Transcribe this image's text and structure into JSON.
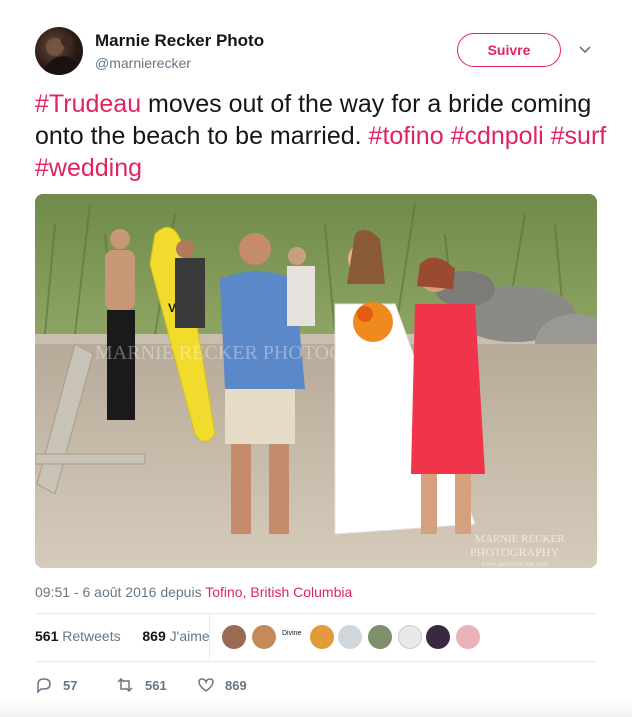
{
  "header": {
    "display_name": "Marnie Recker Photo",
    "handle": "@marnierecker",
    "follow_label": "Suivre"
  },
  "tweet": {
    "segments": [
      {
        "text": "#Trudeau",
        "hashtag": true
      },
      {
        "text": " moves out of the way for a bride coming onto the beach to be married. ",
        "hashtag": false
      },
      {
        "text": "#tofino",
        "hashtag": true
      },
      {
        "text": " ",
        "hashtag": false
      },
      {
        "text": "#cdnpoli",
        "hashtag": true
      },
      {
        "text": " ",
        "hashtag": false
      },
      {
        "text": "#surf",
        "hashtag": true
      },
      {
        "text": " ",
        "hashtag": false
      },
      {
        "text": "#wedding",
        "hashtag": true
      }
    ]
  },
  "photo": {
    "watermark_left": "MARNIE RECKER PHOTOGRAPHY",
    "watermark_right_1": "MARNIE RECKER",
    "watermark_right_2": "PHOTOGRAPHY",
    "watermark_right_3": "www.marnierecker.com",
    "surfboard_logo": "VS"
  },
  "meta": {
    "timestamp": "09:51 - 6 août 2016 depuis ",
    "place": "Tofino, British Columbia"
  },
  "stats": {
    "retweets_count": "561",
    "retweets_label": " Retweets",
    "likes_count": "869",
    "likes_label": " J'aime",
    "divine_label": "Divine"
  },
  "actions": {
    "reply_count": "57",
    "retweet_count": "561",
    "like_count": "869"
  },
  "colors": {
    "accent": "#e0245e",
    "text": "#14171a",
    "muted": "#657786",
    "divider": "#e6ecf0"
  },
  "icons": [
    "chevron-down-icon",
    "reply-icon",
    "retweet-icon",
    "heart-icon"
  ]
}
